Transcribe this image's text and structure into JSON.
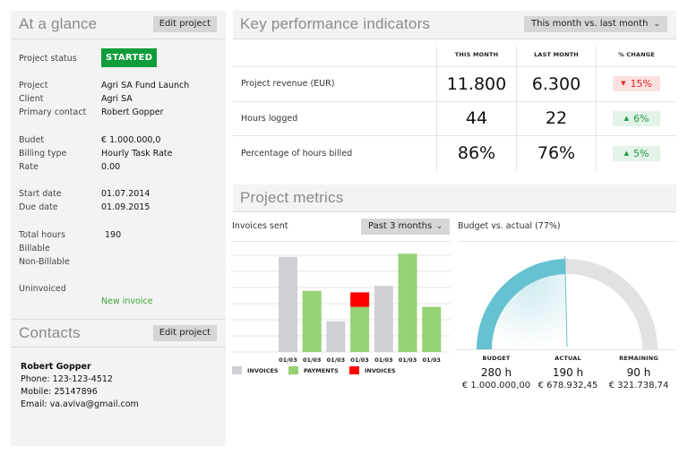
{
  "at_a_glance": {
    "title": "At a glance",
    "edit_button": "Edit project",
    "status_label": "Project status",
    "status_value": "STARTED",
    "status_color": "#0f9d3b",
    "fields": [
      {
        "label": "Project",
        "value": "Agri SA Fund Launch"
      },
      {
        "label": "Client",
        "value": "Agri SA"
      },
      {
        "label": "Primary contact",
        "value": "Robert Gopper"
      },
      {
        "label": "Budet",
        "value": "€ 1.000.000,0"
      },
      {
        "label": "Billing type",
        "value": "Hourly Task Rate"
      },
      {
        "label": "Rate",
        "value": "0.00"
      },
      {
        "label": "Start date",
        "value": "01.07.2014"
      },
      {
        "label": "Due date",
        "value": "01.09.2015"
      },
      {
        "label": "Total hours",
        "value": "190"
      },
      {
        "label": "Billable",
        "value": ""
      },
      {
        "label": "Non-Billable",
        "value": ""
      },
      {
        "label": "Uninvoiced",
        "value": ""
      }
    ],
    "new_invoice_link": "New invoice"
  },
  "contacts": {
    "title": "Contacts",
    "edit_button": "Edit project",
    "name": "Robert Gopper",
    "phone": "Phone: 123-123-4512",
    "mobile": "Mobile: 25147896",
    "email": "Email: va.aviva@gmail.com"
  },
  "kpi": {
    "title": "Key performance indicators",
    "period_dropdown": "This month vs. last month",
    "columns": [
      "THIS MONTH",
      "LAST MONTH",
      "% CHANGE"
    ],
    "rows": [
      {
        "label": "Project revenue (EUR)",
        "this_month": "11.800",
        "last_month": "6.300",
        "change": "15%",
        "direction": "down"
      },
      {
        "label": "Hours logged",
        "this_month": "44",
        "last_month": "22",
        "change": "6%",
        "direction": "up"
      },
      {
        "label": "Percentage of hours billed",
        "this_month": "86%",
        "last_month": "76%",
        "change": "5%",
        "direction": "up"
      }
    ],
    "up_color": "#1d9a44",
    "down_color": "#e52222"
  },
  "metrics": {
    "title": "Project metrics",
    "invoices_label": "Invoices sent",
    "range_dropdown": "Past 3 months",
    "budget_label": "Budget vs. actual (77%)"
  },
  "chart_data": [
    {
      "type": "bar",
      "title": "Invoices sent",
      "categories": [
        "01/03",
        "01/03",
        "01/03",
        "01/03",
        "01/03",
        "01/03",
        "01/03"
      ],
      "series": [
        {
          "name": "INVOICES",
          "color": "#d0d0d4",
          "values": [
            5.9,
            0,
            1.9,
            0,
            4.1,
            0,
            0
          ]
        },
        {
          "name": "PAYMENTS",
          "color": "#95d275",
          "values": [
            0,
            3.8,
            0,
            2.8,
            0,
            6.1,
            2.8
          ]
        },
        {
          "name": "INVOICES",
          "color": "#ff0000",
          "values": [
            0,
            0,
            0,
            0.9,
            0,
            0,
            0
          ]
        }
      ],
      "stacked": true,
      "ylim": [
        0,
        6.5
      ],
      "grid": true,
      "legend": "bottom-left",
      "xlabel": "",
      "ylabel": ""
    },
    {
      "type": "gauge",
      "title": "Budget vs. actual (77%)",
      "percent": 77,
      "colors": {
        "filled": "#66c1d1",
        "remaining": "#e2e2e2",
        "needle": "#66c1d1"
      },
      "stats": [
        {
          "label": "BUDGET",
          "hours": "280 h",
          "amount": "€ 1.000.000,00"
        },
        {
          "label": "ACTUAL",
          "hours": "190 h",
          "amount": "€ 678.932,45"
        },
        {
          "label": "REMAINING",
          "hours": "90 h",
          "amount": "€ 321.738,74"
        }
      ]
    }
  ]
}
